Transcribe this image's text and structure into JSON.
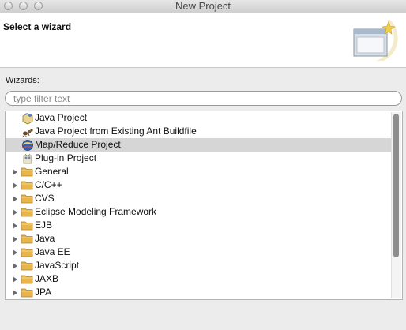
{
  "window": {
    "title": "New Project"
  },
  "banner": {
    "title": "Select a wizard",
    "art_icon": "wizard-art-icon"
  },
  "wizards_label": "Wizards:",
  "filter": {
    "value": "",
    "placeholder": "type filter text"
  },
  "tree": {
    "items": [
      {
        "label": "Java Project",
        "kind": "leaf",
        "icon": "java-project-icon"
      },
      {
        "label": "Java Project from Existing Ant Buildfile",
        "kind": "leaf",
        "icon": "ant-buildfile-icon"
      },
      {
        "label": "Map/Reduce Project",
        "kind": "leaf",
        "icon": "mapreduce-icon",
        "selected": true
      },
      {
        "label": "Plug-in Project",
        "kind": "leaf",
        "icon": "plugin-project-icon"
      },
      {
        "label": "General",
        "kind": "folder"
      },
      {
        "label": "C/C++",
        "kind": "folder"
      },
      {
        "label": "CVS",
        "kind": "folder"
      },
      {
        "label": "Eclipse Modeling Framework",
        "kind": "folder"
      },
      {
        "label": "EJB",
        "kind": "folder"
      },
      {
        "label": "Java",
        "kind": "folder"
      },
      {
        "label": "Java EE",
        "kind": "folder"
      },
      {
        "label": "JavaScript",
        "kind": "folder"
      },
      {
        "label": "JAXB",
        "kind": "folder"
      },
      {
        "label": "JPA",
        "kind": "folder"
      }
    ]
  },
  "colors": {
    "selection": "#d6d6d6",
    "folder": "#e8b54a"
  }
}
